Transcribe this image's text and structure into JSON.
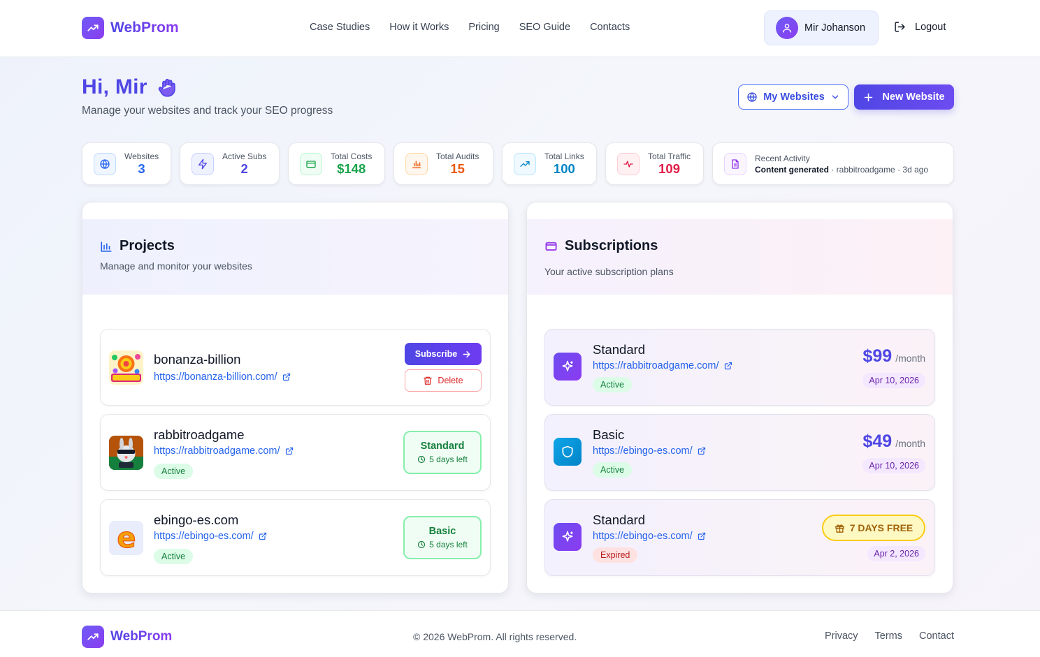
{
  "brand": {
    "name": "WebProm"
  },
  "nav": [
    "Case Studies",
    "How it Works",
    "Pricing",
    "SEO Guide",
    "Contacts"
  ],
  "user": {
    "name": "Mir Johanson",
    "logout_label": "Logout"
  },
  "greeting": {
    "title": "Hi, Mir",
    "subtitle": "Manage your websites and track your SEO progress"
  },
  "actions": {
    "my_websites": "My Websites",
    "new_website": "New Website"
  },
  "stats": [
    {
      "label": "Websites",
      "value": "3",
      "color": "#2563eb"
    },
    {
      "label": "Active Subs",
      "value": "2",
      "color": "#4f46e5"
    },
    {
      "label": "Total Costs",
      "value": "$148",
      "color": "#16a34a"
    },
    {
      "label": "Total Audits",
      "value": "15",
      "color": "#ea580c"
    },
    {
      "label": "Total Links",
      "value": "100",
      "color": "#0284c7"
    },
    {
      "label": "Total Traffic",
      "value": "109",
      "color": "#e11d48"
    }
  ],
  "recent_activity": {
    "label": "Recent Activity",
    "event": "Content generated",
    "detail": " · rabbitroadgame · 3d ago"
  },
  "projects": {
    "title": "Projects",
    "subtitle": "Manage and monitor your websites",
    "items": [
      {
        "name": "bonanza-billion",
        "url": "https://bonanza-billion.com/",
        "subscribe_label": "Subscribe",
        "delete_label": "Delete"
      },
      {
        "name": "rabbitroadgame",
        "url": "https://rabbitroadgame.com/",
        "status": "Active",
        "plan": "Standard",
        "days_left": "5 days left"
      },
      {
        "name": "ebingo-es.com",
        "url": "https://ebingo-es.com/",
        "status": "Active",
        "plan": "Basic",
        "days_left": "5 days left"
      }
    ]
  },
  "subscriptions": {
    "title": "Subscriptions",
    "subtitle": "Your active subscription plans",
    "items": [
      {
        "plan": "Standard",
        "url": "https://rabbitroadgame.com/",
        "status": "Active",
        "price": "$99",
        "period": "/month",
        "date": "Apr 10, 2026"
      },
      {
        "plan": "Basic",
        "url": "https://ebingo-es.com/",
        "status": "Active",
        "price": "$49",
        "period": "/month",
        "date": "Apr 10, 2026"
      },
      {
        "plan": "Standard",
        "url": "https://ebingo-es.com/",
        "status": "Expired",
        "badge": "7 DAYS FREE",
        "date": "Apr 2, 2026"
      }
    ]
  },
  "footer": {
    "copyright": "© 2026 WebProm. All rights reserved.",
    "links": [
      "Privacy",
      "Terms",
      "Contact"
    ]
  }
}
